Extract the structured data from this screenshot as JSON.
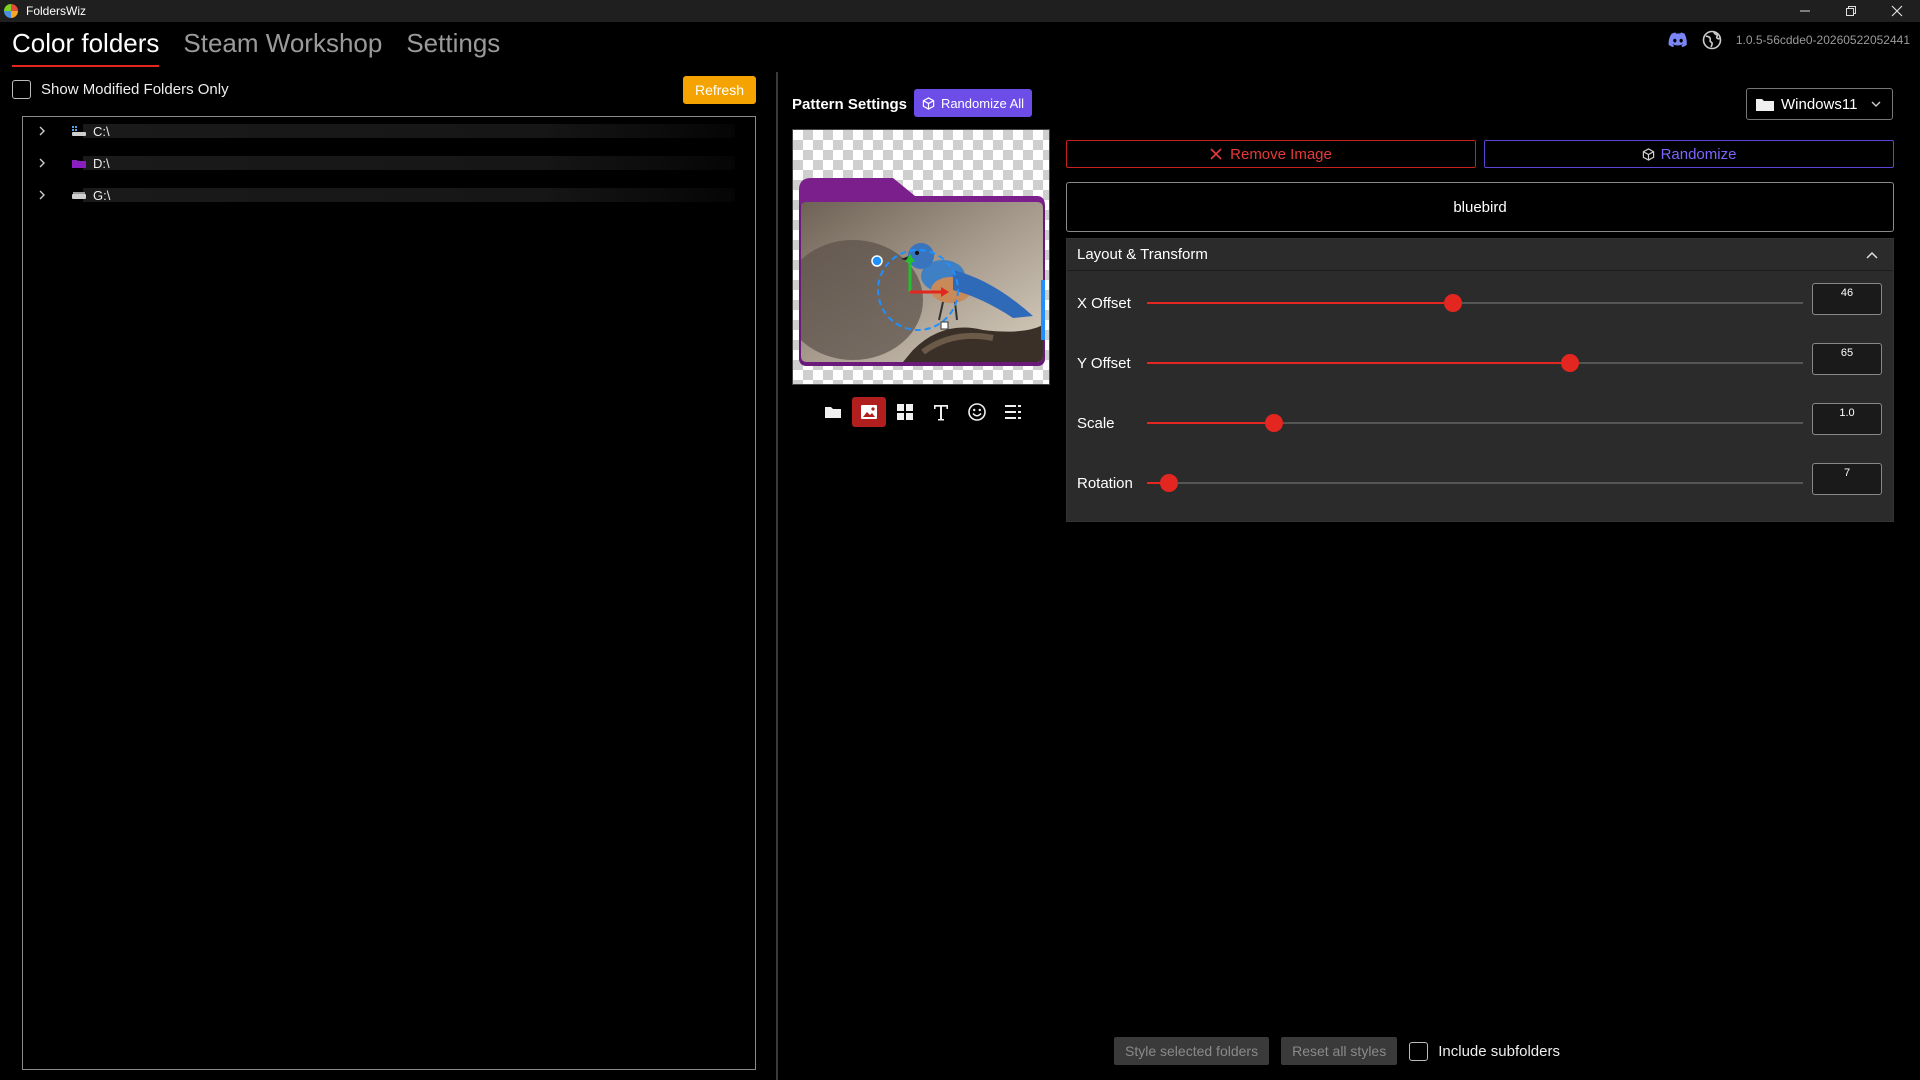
{
  "window": {
    "title": "FoldersWiz"
  },
  "nav": {
    "tabs": [
      {
        "label": "Color folders",
        "active": true
      },
      {
        "label": "Steam Workshop",
        "active": false
      },
      {
        "label": "Settings",
        "active": false
      }
    ],
    "version": "1.0.5-56cdde0-20260522052441"
  },
  "left": {
    "show_modified_label": "Show Modified Folders Only",
    "show_modified_checked": false,
    "refresh_label": "Refresh",
    "drives": [
      {
        "label": "C:\\",
        "icon": "drive-c-icon",
        "color": "#5aa0e8"
      },
      {
        "label": "D:\\",
        "icon": "drive-d-icon",
        "color": "#8a1fc0"
      },
      {
        "label": "G:\\",
        "icon": "drive-g-icon",
        "color": "#cfcfcf"
      }
    ]
  },
  "pattern": {
    "title": "Pattern Settings",
    "randomize_all_label": "Randomize All",
    "os_select": "Windows11",
    "remove_image_label": "Remove Image",
    "randomize_label": "Randomize",
    "image_name": "bluebird",
    "tools": [
      "folder-icon",
      "image-icon",
      "grid-icon",
      "text-icon",
      "emoji-icon",
      "list-icon"
    ],
    "active_tool": 1
  },
  "layout": {
    "title": "Layout & Transform",
    "sliders": [
      {
        "label": "X Offset",
        "value": "46",
        "fraction": 0.467
      },
      {
        "label": "Y Offset",
        "value": "65",
        "fraction": 0.645
      },
      {
        "label": "Scale",
        "value": "1.0",
        "fraction": 0.193
      },
      {
        "label": "Rotation",
        "value": "7",
        "fraction": 0.033
      }
    ]
  },
  "bottom": {
    "style_selected_label": "Style selected folders",
    "reset_all_label": "Reset all styles",
    "include_subfolders_label": "Include subfolders",
    "include_subfolders_checked": false
  },
  "colors": {
    "accent_red": "#e3261f",
    "refresh_orange": "#f5a300",
    "randomize_purple": "#6c4de8",
    "folder_purple": "#7a1f8c"
  }
}
